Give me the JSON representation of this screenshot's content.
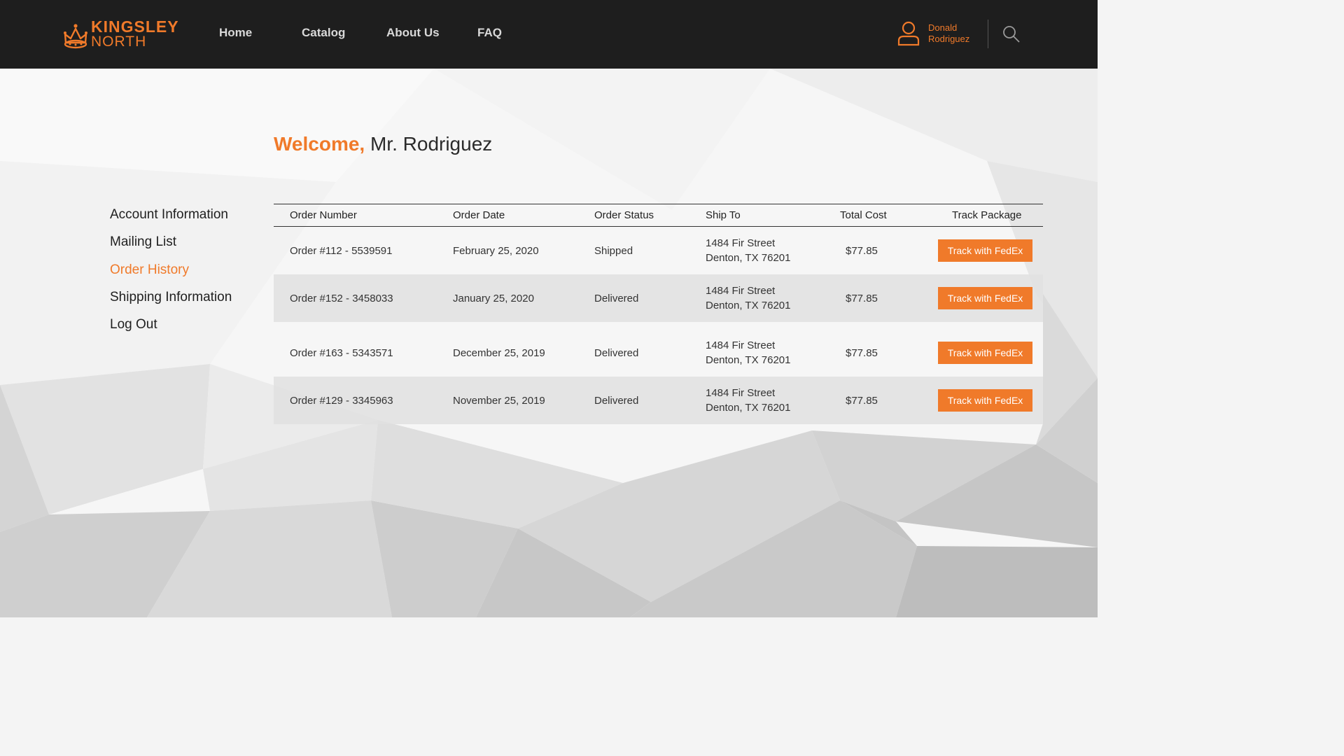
{
  "brand": {
    "line1": "KINGSLEY",
    "line2": "NORTH",
    "accent": "#f07a2a",
    "header_bg": "#1e1e1e"
  },
  "nav": {
    "items": [
      {
        "label": "Home"
      },
      {
        "label": "Catalog"
      },
      {
        "label": "About Us"
      },
      {
        "label": "FAQ"
      }
    ]
  },
  "user": {
    "first_name": "Donald",
    "last_name": "Rodriguez",
    "icon": "user-icon"
  },
  "search": {
    "icon": "search-icon"
  },
  "welcome": {
    "greeting": "Welcome,",
    "name": "Mr. Rodriguez"
  },
  "sidebar": {
    "items": [
      {
        "label": "Account Information",
        "active": false
      },
      {
        "label": "Mailing List",
        "active": false
      },
      {
        "label": "Order History",
        "active": true
      },
      {
        "label": "Shipping Information",
        "active": false
      },
      {
        "label": "Log Out",
        "active": false
      }
    ]
  },
  "orders": {
    "columns": [
      "Order Number",
      "Order Date",
      "Order Status",
      "Ship To",
      "Total Cost",
      "Track Package"
    ],
    "rows": [
      {
        "number": "Order #112 - 5539591",
        "date": "February 25, 2020",
        "status": "Shipped",
        "address_line1": "1484 Fir Street",
        "address_line2": "Denton, TX 76201",
        "total": "$77.85",
        "track_label": "Track with FedEx"
      },
      {
        "number": "Order #152 - 3458033",
        "date": "January 25, 2020",
        "status": "Delivered",
        "address_line1": "1484 Fir Street",
        "address_line2": "Denton, TX 76201",
        "total": "$77.85",
        "track_label": "Track with FedEx"
      },
      {
        "number": "Order #163 - 5343571",
        "date": "December 25, 2019",
        "status": "Delivered",
        "address_line1": "1484 Fir Street",
        "address_line2": "Denton, TX 76201",
        "total": "$77.85",
        "track_label": "Track with FedEx"
      },
      {
        "number": "Order #129 - 3345963",
        "date": "November 25, 2019",
        "status": "Delivered",
        "address_line1": "1484 Fir Street",
        "address_line2": "Denton, TX 76201",
        "total": "$77.85",
        "track_label": "Track with FedEx"
      }
    ]
  }
}
